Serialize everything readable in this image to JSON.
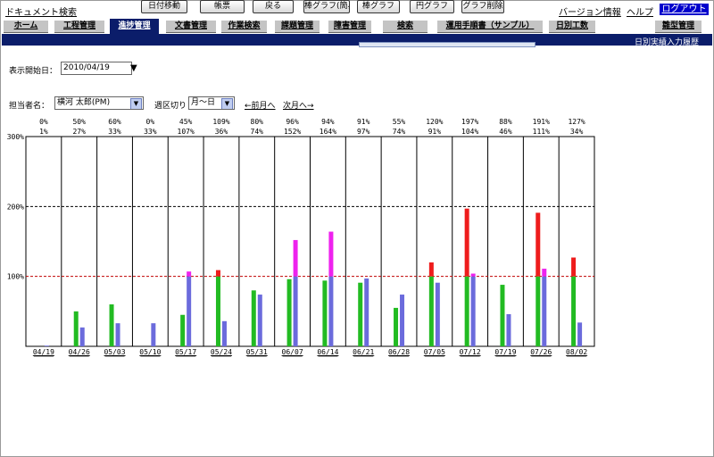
{
  "header": {
    "site_link": "ドキュメント検索",
    "version_link": "バージョン情報",
    "help_link": "ヘルプ",
    "logout_button": "ログアウト"
  },
  "tabs": [
    {
      "label": "ホーム",
      "active": false
    },
    {
      "label": "工程管理",
      "active": false
    },
    {
      "label": "進捗管理",
      "active": true
    },
    {
      "label": "文書管理",
      "active": false
    },
    {
      "label": "作業検索",
      "active": false
    },
    {
      "label": "課題管理",
      "active": false
    },
    {
      "label": "障害管理",
      "active": false
    },
    {
      "label": "検索",
      "active": false
    },
    {
      "label": "運用手順書（サンプル）",
      "active": false
    },
    {
      "label": "日別工数",
      "active": false
    },
    {
      "label": "雛型管理",
      "active": false
    }
  ],
  "subnav": {
    "daily_history_link": "日別実績入力履歴"
  },
  "toolbar": {
    "start_date_label": "表示開始日：",
    "start_date_value": "2010/04/19",
    "date_move_button": "日付移動",
    "report_button": "帳票",
    "back_button": "戻る",
    "bar_graph_simple_button": "棒グラフ(簡易)",
    "bar_graph_button": "棒グラフ",
    "pie_graph_button": "円グラフ",
    "delete_graph_button": "グラフ削除"
  },
  "filters": {
    "assignee_label": "担当者名：",
    "assignee_value": "横河 太郎(PM)",
    "week_split_label": "週区切り",
    "week_split_value": "月～日",
    "prev_month_link": "←前月へ",
    "next_month_link": "次月へ→"
  },
  "colors": {
    "accent_navy": "#0b1d6a",
    "series_red": "#ee1c1c",
    "series_green": "#22bb22",
    "series_magenta": "#ee22ee",
    "series_blue": "#6b6bdc",
    "refline_100": "#c00000",
    "refline_200": "#000000"
  },
  "chart_data": {
    "type": "bar",
    "ylim": [
      0,
      300
    ],
    "y_ticks": [
      "300%",
      "200%",
      "100%"
    ],
    "reference_lines": [
      {
        "value": 100,
        "style": "dashed",
        "color": "red"
      },
      {
        "value": 200,
        "style": "dashed",
        "color": "black"
      }
    ],
    "categories": [
      "04/19",
      "04/26",
      "05/03",
      "05/10",
      "05/17",
      "05/24",
      "05/31",
      "06/07",
      "06/14",
      "06/21",
      "06/28",
      "07/05",
      "07/12",
      "07/19",
      "07/26",
      "08/02"
    ],
    "series": [
      {
        "values": [
          0,
          50,
          60,
          0,
          45,
          109,
          80,
          96,
          94,
          91,
          55,
          120,
          197,
          88,
          191,
          127
        ]
      },
      {
        "values": [
          1,
          27,
          33,
          33,
          107,
          36,
          74,
          152,
          164,
          97,
          74,
          91,
          104,
          46,
          111,
          34
        ]
      }
    ],
    "top_labels_row1": [
      "0%",
      "50%",
      "60%",
      "0%",
      "45%",
      "109%",
      "80%",
      "96%",
      "94%",
      "91%",
      "55%",
      "120%",
      "197%",
      "88%",
      "191%",
      "127%"
    ],
    "top_labels_row2": [
      "1%",
      "27%",
      "33%",
      "33%",
      "107%",
      "36%",
      "74%",
      "152%",
      "164%",
      "97%",
      "74%",
      "91%",
      "104%",
      "46%",
      "111%",
      "34%"
    ]
  }
}
